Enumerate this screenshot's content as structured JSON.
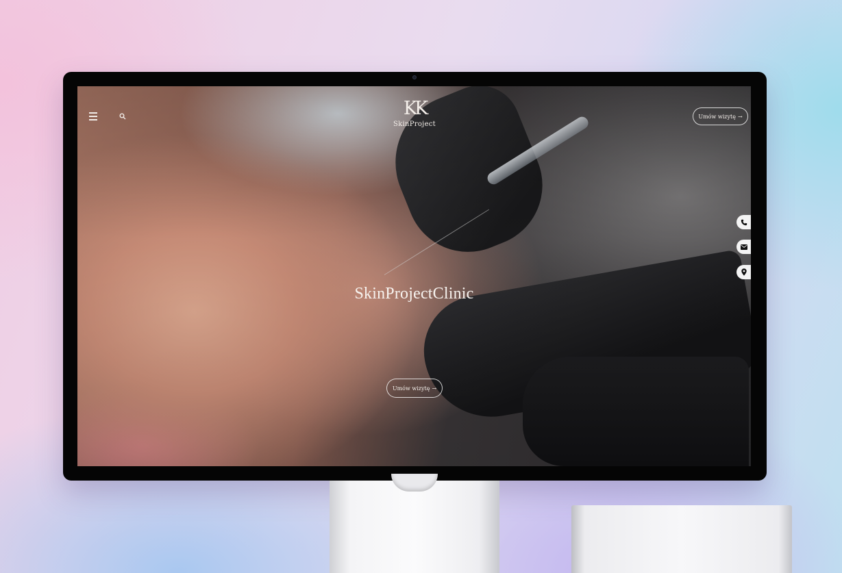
{
  "site": {
    "logo_mark": "KK",
    "logo_word": "SkinProject",
    "header_cta": "Umów wizytę",
    "hero_title": "SkinProjectClinic",
    "hero_cta": "Umów wizytę",
    "arrow": "→"
  },
  "icons": {
    "menu": "hamburger-menu-icon",
    "search": "search-icon",
    "side": [
      "phone-icon",
      "mail-icon",
      "map-pin-icon"
    ]
  },
  "colors": {
    "accent_text": "#f6f1ec",
    "side_bubble": "#f4f4f4",
    "bezel": "#050505"
  }
}
